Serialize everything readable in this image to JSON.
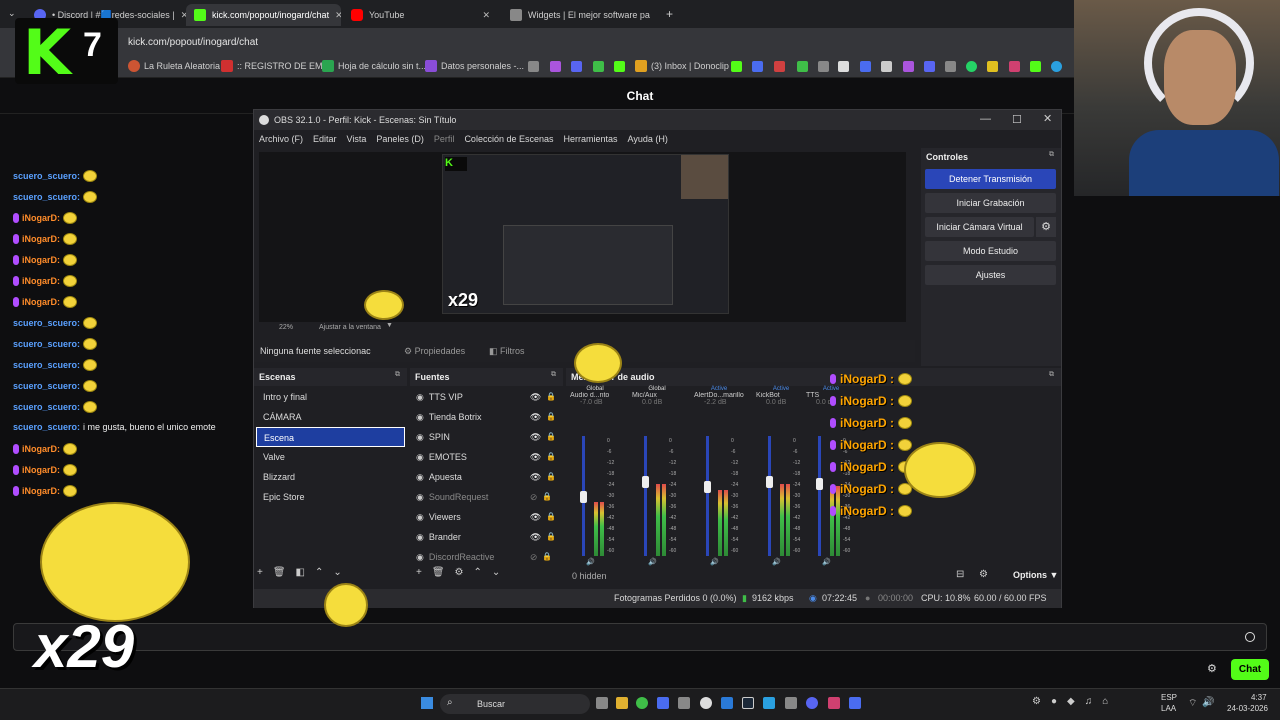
{
  "browser": {
    "tabs": [
      {
        "label": "• Discord | #🟦redes-sociales |",
        "active": false,
        "icon_color": "#5865f2"
      },
      {
        "label": "kick.com/popout/inogard/chat",
        "active": true,
        "icon_color": "#53fc18"
      },
      {
        "label": "YouTube",
        "active": false,
        "icon_color": "#ff0000"
      },
      {
        "label": "Widgets | El mejor software pa",
        "active": false,
        "icon_color": "#888888"
      }
    ],
    "new_tab": "+",
    "url": "kick.com/popout/inogard/chat",
    "bookmarks": [
      "La Ruleta Aleatoria",
      ":: REGISTRO DE EM...",
      "Hoja de cálculo sin t...",
      "Datos personales -...",
      "(3) Inbox | Donoclip"
    ]
  },
  "logo": {
    "letter": "K",
    "number": "7",
    "color": "#53fc18"
  },
  "chat": {
    "title": "Chat",
    "messages": [
      {
        "user": "scuero_scuero:",
        "text": "",
        "style": "u1"
      },
      {
        "user": "scuero_scuero:",
        "text": "",
        "style": "u1"
      },
      {
        "user": "iNogarD:",
        "text": "",
        "style": "u2"
      },
      {
        "user": "iNogarD:",
        "text": "",
        "style": "u2"
      },
      {
        "user": "iNogarD:",
        "text": "",
        "style": "u2"
      },
      {
        "user": "iNogarD:",
        "text": "",
        "style": "u2"
      },
      {
        "user": "iNogarD:",
        "text": "",
        "style": "u2"
      },
      {
        "user": "scuero_scuero:",
        "text": "",
        "style": "u1"
      },
      {
        "user": "scuero_scuero:",
        "text": "",
        "style": "u1"
      },
      {
        "user": "scuero_scuero:",
        "text": "",
        "style": "u1"
      },
      {
        "user": "scuero_scuero:",
        "text": "",
        "style": "u1"
      },
      {
        "user": "scuero_scuero:",
        "text": "",
        "style": "u1"
      },
      {
        "user": "scuero_scuero:",
        "text": "i me gusta, bueno el unico emote",
        "style": "u1"
      },
      {
        "user": "iNogarD:",
        "text": "",
        "style": "u2"
      },
      {
        "user": "iNogarD:",
        "text": "",
        "style": "u2"
      },
      {
        "user": "iNogarD:",
        "text": "",
        "style": "u2"
      }
    ],
    "send_button": "Chat",
    "overlay_multiplier": "x29"
  },
  "obs": {
    "title": "OBS 32.1.0 - Perfil: Kick - Escenas: Sin Título",
    "menu": [
      "Archivo (F)",
      "Editar",
      "Vista",
      "Paneles (D)",
      "Perfil",
      "Colección de Escenas",
      "Herramientas",
      "Ayuda (H)"
    ],
    "zoom": "22%",
    "zoom_fit": "Ajustar a la ventana",
    "no_source": "Ninguna fuente seleccionac",
    "properties": "Propiedades",
    "filters": "Filtros",
    "controls": {
      "title": "Controles",
      "buttons": [
        "Detener Transmisión",
        "Iniciar Grabación",
        "Iniciar Cámara Virtual",
        "Modo Estudio",
        "Ajustes"
      ]
    },
    "scenes": {
      "title": "Escenas",
      "items": [
        "Intro y final",
        "CÁMARA",
        "Escena",
        "Valve",
        "Blizzard",
        "Epic Store"
      ],
      "selected_index": 2
    },
    "sources": {
      "title": "Fuentes",
      "items": [
        {
          "name": "TTS VIP",
          "visible": true
        },
        {
          "name": "Tienda Botrix",
          "visible": true
        },
        {
          "name": "SPIN",
          "visible": true
        },
        {
          "name": "EMOTES",
          "visible": true
        },
        {
          "name": "Apuesta",
          "visible": true
        },
        {
          "name": "SoundRequest",
          "visible": false
        },
        {
          "name": "Viewers",
          "visible": true
        },
        {
          "name": "Brander",
          "visible": true
        },
        {
          "name": "DiscordReactive",
          "visible": false
        }
      ]
    },
    "mixer": {
      "title": "Mezclador de audio",
      "channels": [
        {
          "tag": "Global",
          "name": "Audio d...nto",
          "db": "-7.0 dB",
          "level": 0.45
        },
        {
          "tag": "Global",
          "name": "Mic/Aux",
          "db": "0.0 dB",
          "level": 0.6
        },
        {
          "tag": "Active",
          "name": "AlertDo...marillo",
          "db": "-2.2 dB",
          "level": 0.55
        },
        {
          "tag": "Active",
          "name": "KickBot",
          "db": "0.0 dB",
          "level": 0.6
        },
        {
          "tag": "Active",
          "name": "TTS",
          "db": "0.0 dB",
          "level": 0.58
        }
      ],
      "scale": [
        "0",
        "-6",
        "-12",
        "-18",
        "-24",
        "-30",
        "-36",
        "-42",
        "-48",
        "-54",
        "-60"
      ],
      "hidden": "0 hidden",
      "options": "Options"
    },
    "status": {
      "frames_lost": "Fotogramas Perdidos 0 (0.0%)",
      "bitrate": "9162 kbps",
      "live_time": "07:22:45",
      "rec_time": "00:00:00",
      "cpu": "CPU: 10.8%",
      "fps": "60.00 / 60.00 FPS"
    }
  },
  "alerts": {
    "user": "iNogarD :",
    "count": 7,
    "color": "#ffa500"
  },
  "taskbar": {
    "search": "Buscar",
    "lang": "ESP",
    "region": "LAA",
    "time": "4:37",
    "date": "24-03-2026"
  }
}
